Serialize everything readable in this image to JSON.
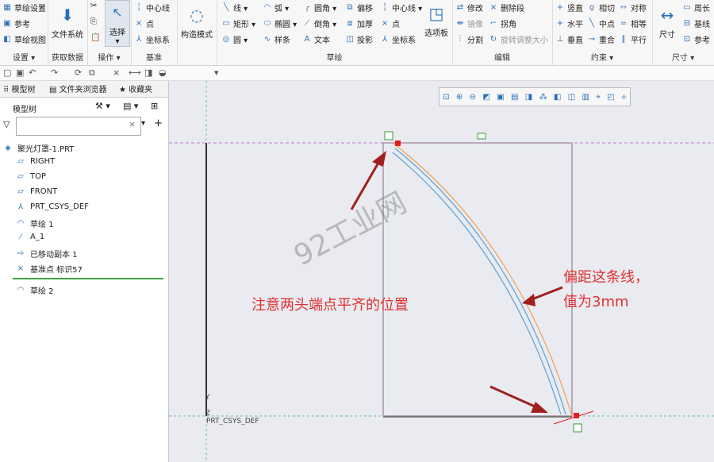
{
  "ribbon": {
    "setup": {
      "items": [
        "草绘设置",
        "参考",
        "草绘视图"
      ],
      "label": "设置 ▾"
    },
    "get_data": {
      "button": "文件系统",
      "label": "获取数据"
    },
    "ops": {
      "button": "选择",
      "label": "操作 ▾"
    },
    "datum": {
      "items": [
        "中心线",
        "点",
        "坐标系"
      ],
      "label": "基准"
    },
    "construct": {
      "button": "构造模式"
    },
    "sketch": {
      "col1": [
        "线 ▾",
        "矩形 ▾",
        "圆 ▾"
      ],
      "col2": [
        "弧 ▾",
        "椭圆 ▾",
        "样条"
      ],
      "col3": [
        "圆角 ▾",
        "倒角 ▾",
        "文本"
      ],
      "col4": [
        "偏移",
        "加厚",
        "投影"
      ],
      "col5": [
        "中心线 ▾",
        "点",
        "坐标系"
      ],
      "label": "草绘"
    },
    "options_panel": "选项板",
    "edit": {
      "col1": [
        "修改",
        "镜像",
        "分割"
      ],
      "col2": [
        "删除段",
        "拐角",
        "旋转调整大小"
      ],
      "label": "编辑"
    },
    "constrain": {
      "col1": [
        "竖直",
        "水平",
        "垂直"
      ],
      "col2": [
        "相切",
        "中点",
        "重合"
      ],
      "col3": [
        "对称",
        "相等",
        "平行"
      ],
      "label": "约束 ▾"
    },
    "dimension": {
      "button": "尺寸",
      "items": [
        "周长",
        "基线",
        "参考"
      ],
      "label": "尺寸 ▾"
    }
  },
  "tabs": [
    "模型树",
    "文件夹浏览器",
    "收藏夹"
  ],
  "tree_header": "模型树",
  "filter_placeholder": "",
  "tree": [
    {
      "icon": "part-icon",
      "label": "聚光灯罩-1.PRT"
    },
    {
      "icon": "plane-icon",
      "label": "RIGHT"
    },
    {
      "icon": "plane-icon",
      "label": "TOP"
    },
    {
      "icon": "plane-icon",
      "label": "FRONT"
    },
    {
      "icon": "csys-icon",
      "label": "PRT_CSYS_DEF"
    },
    {
      "icon": "sketch-icon",
      "label": "草绘 1"
    },
    {
      "icon": "axis-icon",
      "label": "A_1"
    },
    {
      "icon": "move-copy-icon",
      "label": "已移动副本 1"
    },
    {
      "icon": "datum-point-icon",
      "label": "基准点 标识57"
    },
    {
      "icon": "sketch-icon",
      "label": "草绘 2"
    }
  ],
  "canvas": {
    "watermark": "92工业网",
    "note_left": "注意两头端点平齐的位置",
    "note_right_1": "偏距这条线，",
    "note_right_2": "值为3mm",
    "csys_label": "PRT_CSYS_DEF",
    "axis_y": "Y",
    "axis_z": "Z"
  },
  "colors": {
    "annotation": "#e03030",
    "arc_blue": "#5aa0d8",
    "arc_orange": "#f0a050",
    "box": "#9a7f9a"
  }
}
